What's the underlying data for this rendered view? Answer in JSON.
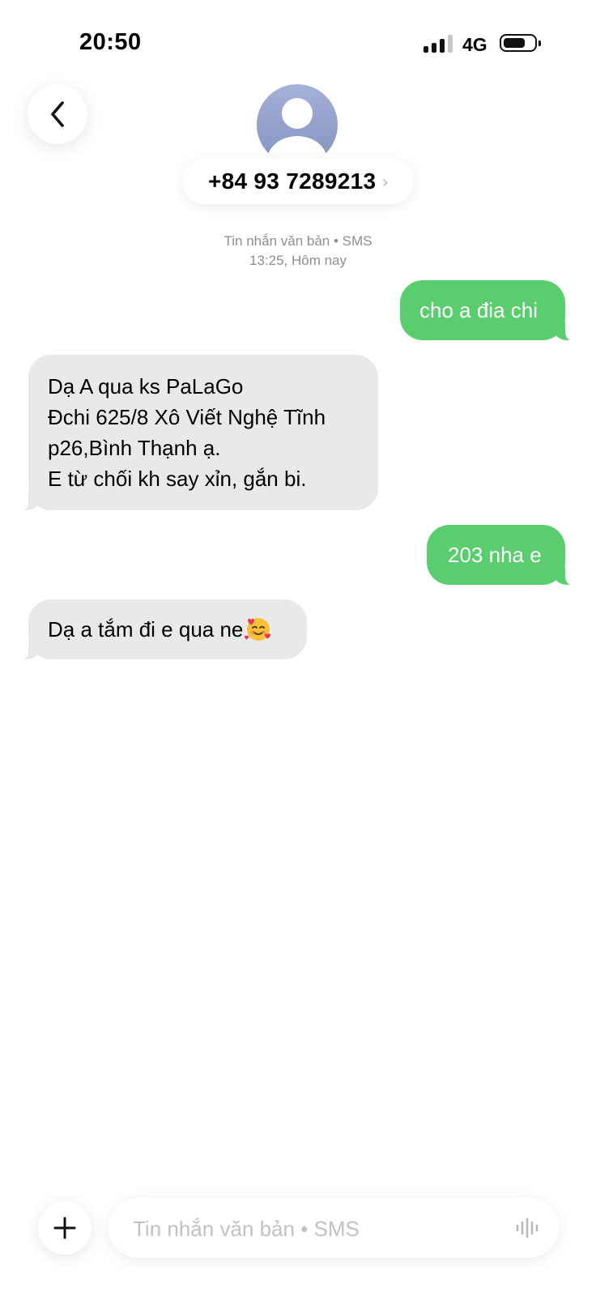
{
  "status_bar": {
    "time": "20:50",
    "network": "4G",
    "signal_bars_filled": 3,
    "signal_bars_total": 4,
    "battery_level": 0.6
  },
  "header": {
    "back_icon": "chevron-left-icon",
    "avatar_icon": "person-silhouette-icon",
    "contact_number": "+84 93 7289213",
    "contact_chevron": "›"
  },
  "thread": {
    "meta_type": "Tin nhắn văn bản • SMS",
    "meta_time": "13:25, Hôm nay"
  },
  "messages": [
    {
      "direction": "outgoing",
      "lines": [
        "cho a đia chi"
      ]
    },
    {
      "direction": "incoming",
      "lines": [
        "Dạ A qua ks PaLaGo",
        "Đchi 625/8 Xô Viết Nghệ Tĩnh",
        "p26,Bình Thạnh ạ.",
        "E từ chối kh say xỉn, gắn bi."
      ]
    },
    {
      "direction": "outgoing",
      "lines": [
        "203 nha e"
      ]
    },
    {
      "direction": "incoming",
      "lines": [
        "Dạ a tắm đi e qua ne"
      ],
      "emoji": "smiling-face-with-hearts"
    }
  ],
  "composer": {
    "add_icon": "plus-icon",
    "placeholder": "Tin nhắn văn bản • SMS",
    "value": "",
    "mic_icon": "waveform-icon"
  },
  "colors": {
    "outgoing_bubble": "#5ace6e",
    "incoming_bubble": "#e9e9eb",
    "meta_text": "#8e8e93",
    "placeholder_text": "#c1c1c6"
  }
}
